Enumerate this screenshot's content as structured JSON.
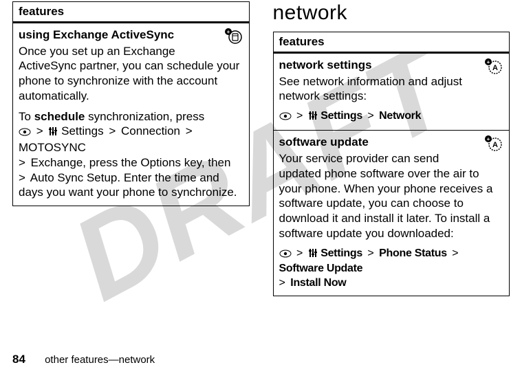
{
  "watermark": "DRAFT",
  "left": {
    "header": "features",
    "row1": {
      "title": "using Exchange ActiveSync",
      "p1": "Once you set up an Exchange ActiveSync partner, you can schedule your phone to synchronize with the account automatically.",
      "p2_prefix": "To ",
      "p2_bold": "schedule",
      "p2_after": " synchronization, press ",
      "nav1_settings": "Settings",
      "nav1_connection": "Connection",
      "nav1_motosync": "MOTOSYNC",
      "nav1_exchange": "Exchange",
      "p2_mid": ", press the ",
      "nav1_options": "Options",
      "p2_mid2": " key, then ",
      "nav1_autosync": "Auto Sync Setup",
      "p2_tail": ". Enter the time and days you want your phone to synchronize."
    }
  },
  "right": {
    "section_title": "network",
    "header": "features",
    "row1": {
      "title": "network settings",
      "p1": "See network information and adjust network settings:",
      "nav_settings": "Settings",
      "nav_network": "Network"
    },
    "row2": {
      "title": "software update",
      "p1": "Your service provider can send updated phone software over the air to your phone. When your phone receives a software update, you can choose to download it and install it later. To install a software update you downloaded:",
      "nav_settings": "Settings",
      "nav_phonestatus": "Phone Status",
      "nav_swupdate": "Software Update",
      "nav_installnow": "Install Now"
    }
  },
  "footer": {
    "page": "84",
    "text": "other features—network"
  }
}
